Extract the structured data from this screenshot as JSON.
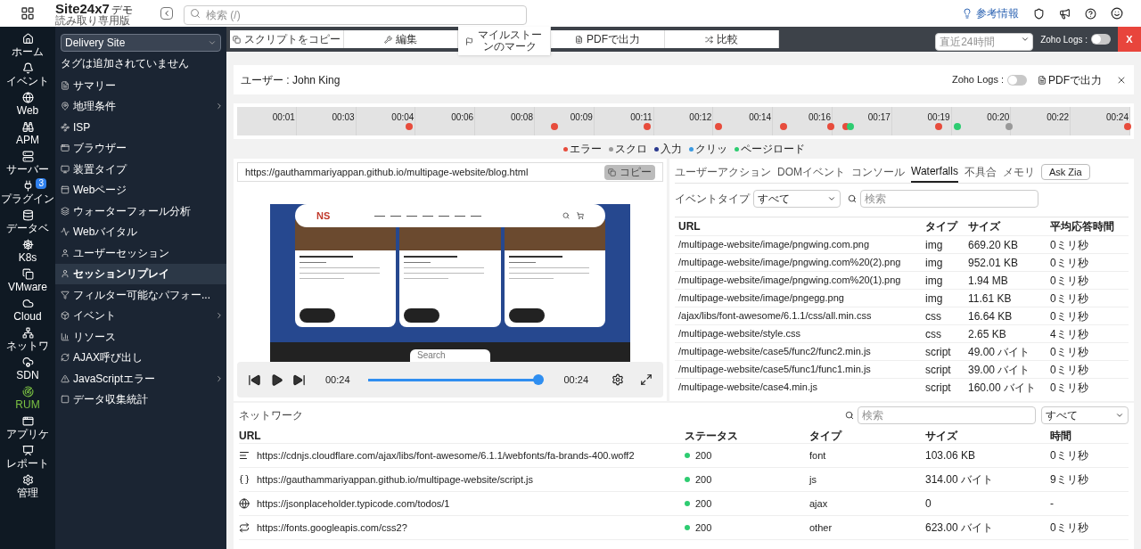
{
  "app": {
    "logo": "Site24x7",
    "logo_suffix": "デモ",
    "subtitle": "読み取り専用版"
  },
  "header": {
    "search": {
      "placeholder": "検索 (/)"
    },
    "help_link": "参考情報"
  },
  "rail": [
    {
      "label": "ホーム",
      "selected": false
    },
    {
      "label": "イベント",
      "selected": false
    },
    {
      "label": "Web",
      "selected": false
    },
    {
      "label": "APM",
      "selected": false
    },
    {
      "label": "サーバー",
      "selected": false
    },
    {
      "label": "プラグイン",
      "selected": false,
      "badge": "3"
    },
    {
      "label": "データベ",
      "selected": false
    },
    {
      "label": "K8s",
      "selected": false
    },
    {
      "label": "VMware",
      "selected": false
    },
    {
      "label": "Cloud",
      "selected": false
    },
    {
      "label": "ネットワ",
      "selected": false
    },
    {
      "label": "SDN",
      "selected": false
    },
    {
      "label": "RUM",
      "selected": true
    },
    {
      "label": "アプリケ",
      "selected": false
    },
    {
      "label": "レポート",
      "selected": false
    },
    {
      "label": "管理",
      "selected": false
    }
  ],
  "sidebar": {
    "site_select": "Delivery Site",
    "tag_note": "タグは追加されていません",
    "items": [
      {
        "label": "サマリー",
        "selected": false,
        "expandable": false
      },
      {
        "label": "地理条件",
        "selected": false,
        "expandable": true
      },
      {
        "label": "ISP",
        "selected": false,
        "expandable": false
      },
      {
        "label": "ブラウザー",
        "selected": false,
        "expandable": false
      },
      {
        "label": "装置タイプ",
        "selected": false,
        "expandable": false
      },
      {
        "label": "Webページ",
        "selected": false,
        "expandable": false
      },
      {
        "label": "ウォーターフォール分析",
        "selected": false,
        "expandable": false
      },
      {
        "label": "Webバイタル",
        "selected": false,
        "expandable": false
      },
      {
        "label": "ユーザーセッション",
        "selected": false,
        "expandable": false
      },
      {
        "label": "セッションリプレイ",
        "selected": true,
        "expandable": false
      },
      {
        "label": "フィルター可能なパフォー...",
        "selected": false,
        "expandable": false
      },
      {
        "label": "イベント",
        "selected": false,
        "expandable": true
      },
      {
        "label": "リソース",
        "selected": false,
        "expandable": false
      },
      {
        "label": "AJAX呼び出し",
        "selected": false,
        "expandable": false
      },
      {
        "label": "JavaScriptエラー",
        "selected": false,
        "expandable": true
      },
      {
        "label": "データ収集統計",
        "selected": false,
        "expandable": false
      }
    ]
  },
  "toolbar": {
    "buttons": [
      "スクリプトをコピー",
      "編集",
      "マイルストーンのマーク",
      "PDFで出力",
      "比較"
    ],
    "time_range": {
      "placeholder": "直近24時間"
    },
    "zoho_logs": {
      "label": "Zoho Logs :",
      "on": false
    },
    "close": "X"
  },
  "session": {
    "title": "ユーザー : John King",
    "zoho_logs": {
      "label": "Zoho Logs :",
      "on": false
    },
    "pdf": "PDFで出力"
  },
  "timeline": {
    "ticks": [
      "00:01",
      "00:03",
      "00:04",
      "00:06",
      "00:08",
      "00:09",
      "00:11",
      "00:12",
      "00:14",
      "00:16",
      "00:17",
      "00:19",
      "00:20",
      "00:22",
      "00:24"
    ],
    "markers": [
      {
        "level": 0.193,
        "color": "#e74c3c"
      },
      {
        "level": 0.355,
        "color": "#e74c3c"
      },
      {
        "level": 0.459,
        "color": "#e74c3c"
      },
      {
        "level": 0.539,
        "color": "#e74c3c"
      },
      {
        "level": 0.612,
        "color": "#e74c3c"
      },
      {
        "level": 0.665,
        "color": "#e74c3c"
      },
      {
        "level": 0.682,
        "color": "#e74c3c"
      },
      {
        "level": 0.687,
        "color": "#2ecc71"
      },
      {
        "level": 0.785,
        "color": "#e74c3c"
      },
      {
        "level": 0.806,
        "color": "#2ecc71"
      },
      {
        "level": 0.864,
        "color": "#999999"
      },
      {
        "level": 0.997,
        "color": "#e74c3c"
      }
    ],
    "legend": [
      {
        "label": "エラー",
        "color": "#e74c3c"
      },
      {
        "label": "スクロ",
        "color": "#999999"
      },
      {
        "label": "入力",
        "color": "#2b3a8f"
      },
      {
        "label": "クリッ",
        "color": "#3b9ae1"
      },
      {
        "label": "ページロード",
        "color": "#2ecc71"
      }
    ]
  },
  "replay": {
    "url": "https://gauthammariyappan.github.io/multipage-website/blog.html",
    "copy": "コピー",
    "page": {
      "logo": "NS",
      "search_placeholder": "Search"
    },
    "player": {
      "elapsed": "00:24",
      "total": "00:24",
      "level": 1
    }
  },
  "detail": {
    "tabs": [
      {
        "label": "ユーザーアクション",
        "selected": false
      },
      {
        "label": "DOMイベント",
        "selected": false
      },
      {
        "label": "コンソール",
        "selected": false
      },
      {
        "label": "Waterfalls",
        "selected": true
      },
      {
        "label": "不具合",
        "selected": false
      },
      {
        "label": "メモリ",
        "selected": false
      }
    ],
    "ask": "Ask Zia",
    "filter_label": "イベントタイプ",
    "filter_value": "すべて",
    "search": {
      "placeholder": "検索"
    },
    "columns": [
      "URL",
      "タイプ",
      "サイズ",
      "平均応答時間"
    ],
    "rows": [
      [
        "/multipage-website/image/pngwing.com.png",
        "img",
        "669.20 KB",
        "0ミリ秒"
      ],
      [
        "/multipage-website/image/pngwing.com%20(2).png",
        "img",
        "952.01 KB",
        "0ミリ秒"
      ],
      [
        "/multipage-website/image/pngwing.com%20(1).png",
        "img",
        "1.94 MB",
        "0ミリ秒"
      ],
      [
        "/multipage-website/image/pngegg.png",
        "img",
        "11.61 KB",
        "0ミリ秒"
      ],
      [
        "/ajax/libs/font-awesome/6.1.1/css/all.min.css",
        "css",
        "16.64 KB",
        "0ミリ秒"
      ],
      [
        "/multipage-website/style.css",
        "css",
        "2.65 KB",
        "4ミリ秒"
      ],
      [
        "/multipage-website/case5/func2/func2.min.js",
        "script",
        "49.00 バイト",
        "0ミリ秒"
      ],
      [
        "/multipage-website/case5/func1/func1.min.js",
        "script",
        "39.00 バイト",
        "0ミリ秒"
      ],
      [
        "/multipage-website/case4.min.js",
        "script",
        "160.00 バイト",
        "0ミリ秒"
      ]
    ]
  },
  "network": {
    "title": "ネットワーク",
    "search": {
      "placeholder": "検索"
    },
    "filter_value": "すべて",
    "columns": [
      "URL",
      "ステータス",
      "タイプ",
      "サイズ",
      "時間"
    ],
    "rows": [
      {
        "kind": "font",
        "url": "https://cdnjs.cloudflare.com/ajax/libs/font-awesome/6.1.1/webfonts/fa-brands-400.woff2",
        "status": "200",
        "type": "font",
        "size": "103.06 KB",
        "time": "0ミリ秒"
      },
      {
        "kind": "script",
        "url": "https://gauthammariyappan.github.io/multipage-website/script.js",
        "status": "200",
        "type": "js",
        "size": "314.00 バイト",
        "time": "9ミリ秒"
      },
      {
        "kind": "ajax",
        "url": "https://jsonplaceholder.typicode.com/todos/1",
        "status": "200",
        "type": "ajax",
        "size": "0",
        "time": "-"
      },
      {
        "kind": "other",
        "url": "https://fonts.googleapis.com/css2?",
        "status": "200",
        "type": "other",
        "size": "623.00 バイト",
        "time": "0ミリ秒"
      }
    ]
  }
}
